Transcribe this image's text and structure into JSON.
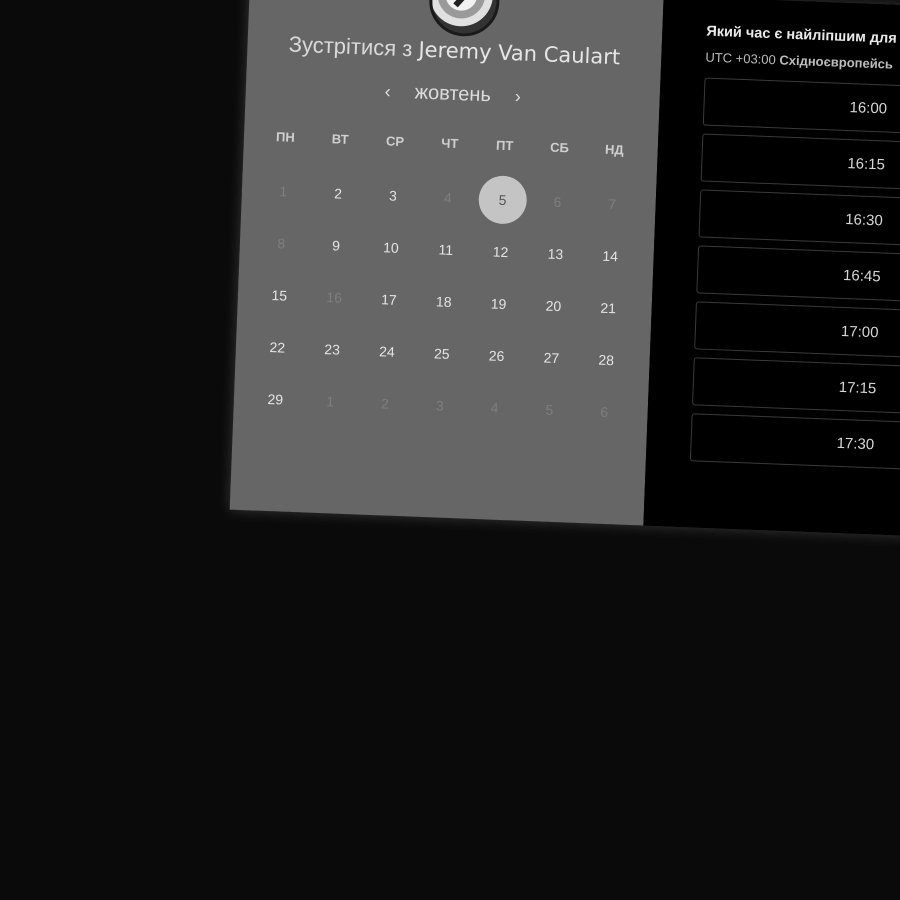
{
  "calendar": {
    "title_prefix": "Зустрітися з",
    "host_name": "Jeremy Van Caulart",
    "month": "жовтень",
    "prev_arrow": "‹",
    "next_arrow": "›",
    "weekdays": [
      "ПН",
      "ВТ",
      "СР",
      "ЧТ",
      "ПТ",
      "СБ",
      "НД"
    ],
    "days": [
      {
        "label": "1",
        "muted": true
      },
      {
        "label": "2",
        "muted": false
      },
      {
        "label": "3",
        "muted": false
      },
      {
        "label": "4",
        "muted": true
      },
      {
        "label": "5",
        "muted": false,
        "selected": true
      },
      {
        "label": "6",
        "muted": true
      },
      {
        "label": "7",
        "muted": true
      },
      {
        "label": "8",
        "muted": true
      },
      {
        "label": "9",
        "muted": false
      },
      {
        "label": "10",
        "muted": false
      },
      {
        "label": "11",
        "muted": false
      },
      {
        "label": "12",
        "muted": false
      },
      {
        "label": "13",
        "muted": false
      },
      {
        "label": "14",
        "muted": false
      },
      {
        "label": "15",
        "muted": false
      },
      {
        "label": "16",
        "muted": true
      },
      {
        "label": "17",
        "muted": false
      },
      {
        "label": "18",
        "muted": false
      },
      {
        "label": "19",
        "muted": false
      },
      {
        "label": "20",
        "muted": false
      },
      {
        "label": "21",
        "muted": false
      },
      {
        "label": "22",
        "muted": false
      },
      {
        "label": "23",
        "muted": false
      },
      {
        "label": "24",
        "muted": false
      },
      {
        "label": "25",
        "muted": false
      },
      {
        "label": "26",
        "muted": false
      },
      {
        "label": "27",
        "muted": false
      },
      {
        "label": "28",
        "muted": false
      },
      {
        "label": "29",
        "muted": false
      },
      {
        "label": "1",
        "muted": true
      },
      {
        "label": "2",
        "muted": true
      },
      {
        "label": "3",
        "muted": true
      },
      {
        "label": "4",
        "muted": true
      },
      {
        "label": "5",
        "muted": true
      },
      {
        "label": "6",
        "muted": true
      }
    ]
  },
  "times": {
    "question": "Який час є найліпшим для",
    "timezone_offset": "UTC +03:00",
    "timezone_name": "Східноєвропейсь",
    "slots": [
      "16:00",
      "16:15",
      "16:30",
      "16:45",
      "17:00",
      "17:15",
      "17:30"
    ]
  },
  "colors": {
    "calendar_bg": "#666666",
    "times_bg": "#000000",
    "page_bg": "#0a0a0a",
    "selected_day_bg": "#c4c4c4"
  },
  "icons": {
    "avatar": "host-avatar-photo",
    "prev": "chevron-left-icon",
    "next": "chevron-right-icon"
  }
}
